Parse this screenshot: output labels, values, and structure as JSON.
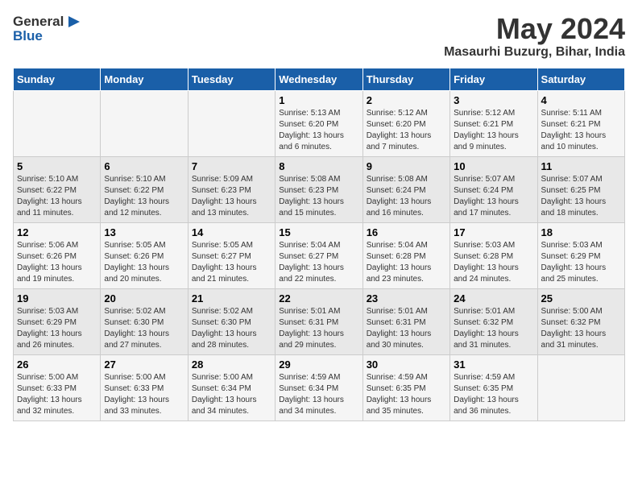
{
  "header": {
    "logo_general": "General",
    "logo_blue": "Blue",
    "main_title": "May 2024",
    "sub_title": "Masaurhi Buzurg, Bihar, India"
  },
  "days_of_week": [
    "Sunday",
    "Monday",
    "Tuesday",
    "Wednesday",
    "Thursday",
    "Friday",
    "Saturday"
  ],
  "weeks": [
    [
      {
        "day": "",
        "info": ""
      },
      {
        "day": "",
        "info": ""
      },
      {
        "day": "",
        "info": ""
      },
      {
        "day": "1",
        "info": "Sunrise: 5:13 AM\nSunset: 6:20 PM\nDaylight: 13 hours and 6 minutes."
      },
      {
        "day": "2",
        "info": "Sunrise: 5:12 AM\nSunset: 6:20 PM\nDaylight: 13 hours and 7 minutes."
      },
      {
        "day": "3",
        "info": "Sunrise: 5:12 AM\nSunset: 6:21 PM\nDaylight: 13 hours and 9 minutes."
      },
      {
        "day": "4",
        "info": "Sunrise: 5:11 AM\nSunset: 6:21 PM\nDaylight: 13 hours and 10 minutes."
      }
    ],
    [
      {
        "day": "5",
        "info": "Sunrise: 5:10 AM\nSunset: 6:22 PM\nDaylight: 13 hours and 11 minutes."
      },
      {
        "day": "6",
        "info": "Sunrise: 5:10 AM\nSunset: 6:22 PM\nDaylight: 13 hours and 12 minutes."
      },
      {
        "day": "7",
        "info": "Sunrise: 5:09 AM\nSunset: 6:23 PM\nDaylight: 13 hours and 13 minutes."
      },
      {
        "day": "8",
        "info": "Sunrise: 5:08 AM\nSunset: 6:23 PM\nDaylight: 13 hours and 15 minutes."
      },
      {
        "day": "9",
        "info": "Sunrise: 5:08 AM\nSunset: 6:24 PM\nDaylight: 13 hours and 16 minutes."
      },
      {
        "day": "10",
        "info": "Sunrise: 5:07 AM\nSunset: 6:24 PM\nDaylight: 13 hours and 17 minutes."
      },
      {
        "day": "11",
        "info": "Sunrise: 5:07 AM\nSunset: 6:25 PM\nDaylight: 13 hours and 18 minutes."
      }
    ],
    [
      {
        "day": "12",
        "info": "Sunrise: 5:06 AM\nSunset: 6:26 PM\nDaylight: 13 hours and 19 minutes."
      },
      {
        "day": "13",
        "info": "Sunrise: 5:05 AM\nSunset: 6:26 PM\nDaylight: 13 hours and 20 minutes."
      },
      {
        "day": "14",
        "info": "Sunrise: 5:05 AM\nSunset: 6:27 PM\nDaylight: 13 hours and 21 minutes."
      },
      {
        "day": "15",
        "info": "Sunrise: 5:04 AM\nSunset: 6:27 PM\nDaylight: 13 hours and 22 minutes."
      },
      {
        "day": "16",
        "info": "Sunrise: 5:04 AM\nSunset: 6:28 PM\nDaylight: 13 hours and 23 minutes."
      },
      {
        "day": "17",
        "info": "Sunrise: 5:03 AM\nSunset: 6:28 PM\nDaylight: 13 hours and 24 minutes."
      },
      {
        "day": "18",
        "info": "Sunrise: 5:03 AM\nSunset: 6:29 PM\nDaylight: 13 hours and 25 minutes."
      }
    ],
    [
      {
        "day": "19",
        "info": "Sunrise: 5:03 AM\nSunset: 6:29 PM\nDaylight: 13 hours and 26 minutes."
      },
      {
        "day": "20",
        "info": "Sunrise: 5:02 AM\nSunset: 6:30 PM\nDaylight: 13 hours and 27 minutes."
      },
      {
        "day": "21",
        "info": "Sunrise: 5:02 AM\nSunset: 6:30 PM\nDaylight: 13 hours and 28 minutes."
      },
      {
        "day": "22",
        "info": "Sunrise: 5:01 AM\nSunset: 6:31 PM\nDaylight: 13 hours and 29 minutes."
      },
      {
        "day": "23",
        "info": "Sunrise: 5:01 AM\nSunset: 6:31 PM\nDaylight: 13 hours and 30 minutes."
      },
      {
        "day": "24",
        "info": "Sunrise: 5:01 AM\nSunset: 6:32 PM\nDaylight: 13 hours and 31 minutes."
      },
      {
        "day": "25",
        "info": "Sunrise: 5:00 AM\nSunset: 6:32 PM\nDaylight: 13 hours and 31 minutes."
      }
    ],
    [
      {
        "day": "26",
        "info": "Sunrise: 5:00 AM\nSunset: 6:33 PM\nDaylight: 13 hours and 32 minutes."
      },
      {
        "day": "27",
        "info": "Sunrise: 5:00 AM\nSunset: 6:33 PM\nDaylight: 13 hours and 33 minutes."
      },
      {
        "day": "28",
        "info": "Sunrise: 5:00 AM\nSunset: 6:34 PM\nDaylight: 13 hours and 34 minutes."
      },
      {
        "day": "29",
        "info": "Sunrise: 4:59 AM\nSunset: 6:34 PM\nDaylight: 13 hours and 34 minutes."
      },
      {
        "day": "30",
        "info": "Sunrise: 4:59 AM\nSunset: 6:35 PM\nDaylight: 13 hours and 35 minutes."
      },
      {
        "day": "31",
        "info": "Sunrise: 4:59 AM\nSunset: 6:35 PM\nDaylight: 13 hours and 36 minutes."
      },
      {
        "day": "",
        "info": ""
      }
    ]
  ]
}
